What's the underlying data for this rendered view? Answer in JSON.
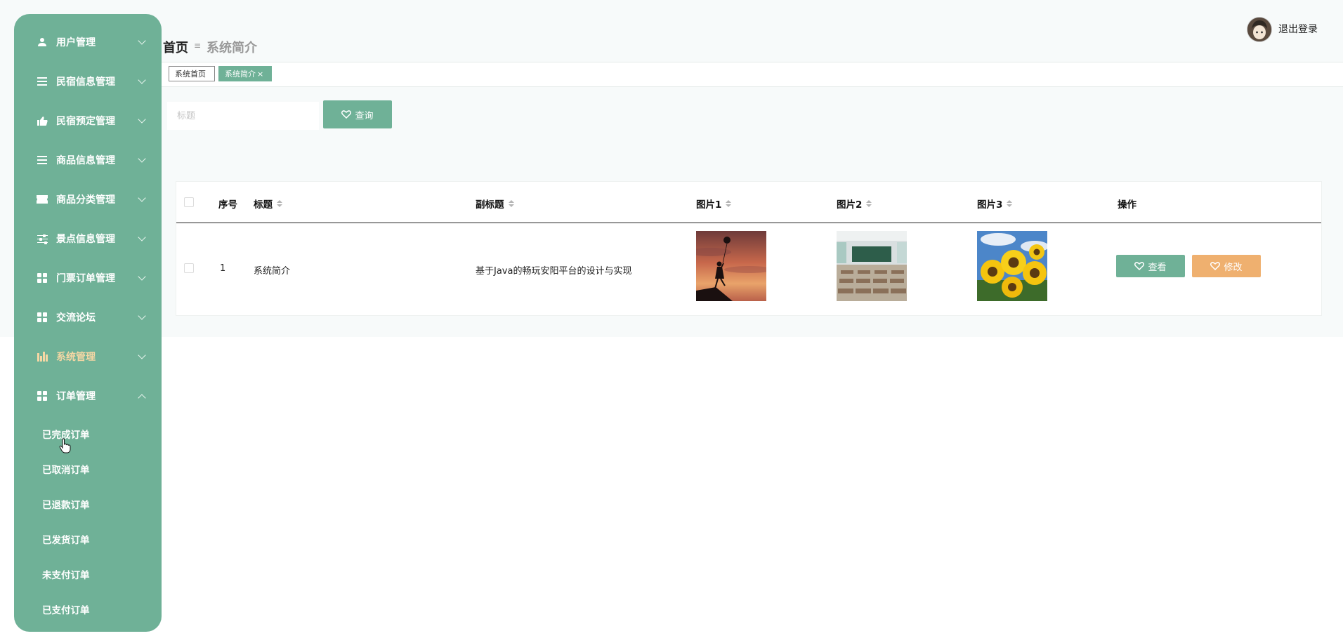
{
  "sidebar": {
    "items": [
      {
        "label": "用户管理",
        "icon": "user-icon"
      },
      {
        "label": "民宿信息管理",
        "icon": "list-icon"
      },
      {
        "label": "民宿预定管理",
        "icon": "thumbs-up-icon"
      },
      {
        "label": "商品信息管理",
        "icon": "list-icon"
      },
      {
        "label": "商品分类管理",
        "icon": "ticket-icon"
      },
      {
        "label": "景点信息管理",
        "icon": "sliders-icon"
      },
      {
        "label": "门票订单管理",
        "icon": "grid-icon"
      },
      {
        "label": "交流论坛",
        "icon": "grid-icon"
      },
      {
        "label": "系统管理",
        "icon": "chart-icon"
      },
      {
        "label": "订单管理",
        "icon": "grid-icon"
      }
    ],
    "submenu": [
      "已完成订单",
      "已取消订单",
      "已退款订单",
      "已发货订单",
      "未支付订单",
      "已支付订单"
    ]
  },
  "header": {
    "breadcrumb_home": "首页",
    "breadcrumb_sep": "≡",
    "breadcrumb_current": "系统简介",
    "logout_label": "退出登录"
  },
  "tags": {
    "home": "系统首页",
    "current": "系统简介",
    "close": "×"
  },
  "search": {
    "placeholder": "标题",
    "button_label": "查询"
  },
  "table": {
    "columns": [
      "序号",
      "标题",
      "副标题",
      "图片1",
      "图片2",
      "图片3",
      "操作"
    ],
    "rows": [
      {
        "index": "1",
        "title": "系统简介",
        "subtitle": "基于Java的畅玩安阳平台的设计与实现",
        "image1": "silhouette-girl-balloon-image",
        "image2": "classroom-image",
        "image3": "sunflowers-image"
      }
    ],
    "view_label": "查看",
    "edit_label": "修改"
  },
  "colors": {
    "primary": "#6fb197",
    "warning": "#efb06f",
    "active_menu_text": "#f6d7a4"
  }
}
